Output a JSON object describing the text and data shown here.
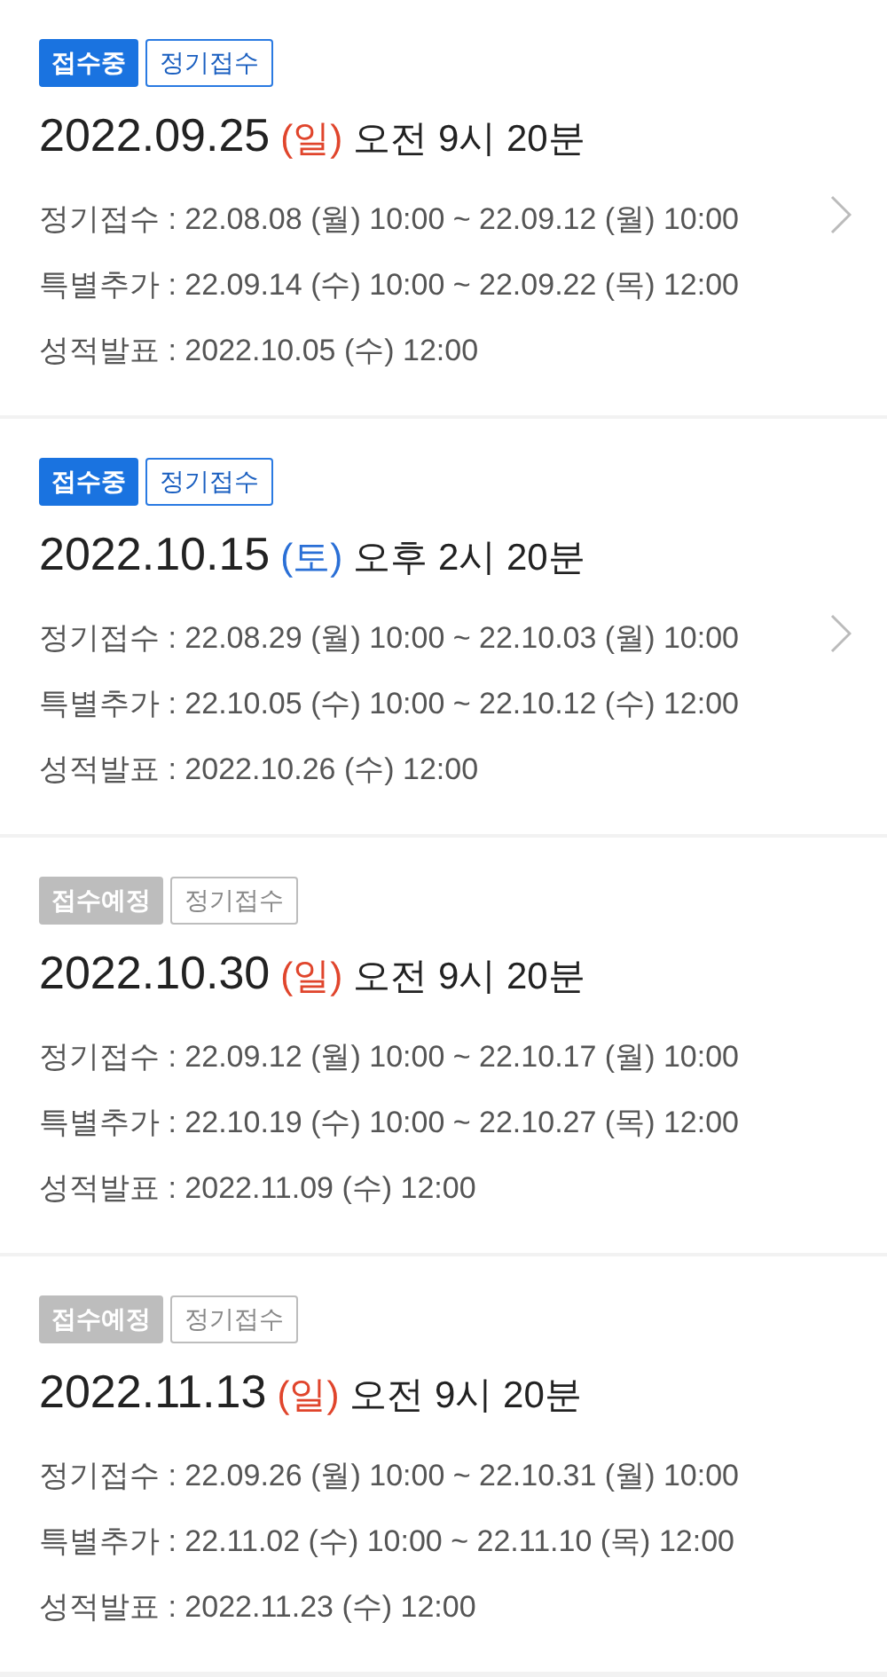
{
  "exams": [
    {
      "status": {
        "label": "접수중",
        "kind": "open"
      },
      "type": "정기접수",
      "date": "2022.09.25",
      "day": {
        "label": "(일)",
        "color": "#e0452c"
      },
      "time": "오전 9시 20분",
      "chevron": true,
      "rows": [
        "정기접수 : 22.08.08 (월) 10:00 ~ 22.09.12 (월) 10:00",
        "특별추가 : 22.09.14 (수) 10:00 ~ 22.09.22 (목) 12:00",
        "성적발표 : 2022.10.05 (수) 12:00"
      ]
    },
    {
      "status": {
        "label": "접수중",
        "kind": "open"
      },
      "type": "정기접수",
      "date": "2022.10.15",
      "day": {
        "label": "(토)",
        "color": "#2a6fd6"
      },
      "time": "오후 2시 20분",
      "chevron": true,
      "rows": [
        "정기접수 : 22.08.29 (월) 10:00 ~ 22.10.03 (월) 10:00",
        "특별추가 : 22.10.05 (수) 10:00 ~ 22.10.12 (수) 12:00",
        "성적발표 : 2022.10.26 (수) 12:00"
      ]
    },
    {
      "status": {
        "label": "접수예정",
        "kind": "upcoming"
      },
      "type": "정기접수",
      "date": "2022.10.30",
      "day": {
        "label": "(일)",
        "color": "#e0452c"
      },
      "time": "오전 9시 20분",
      "chevron": false,
      "rows": [
        "정기접수 : 22.09.12 (월) 10:00 ~ 22.10.17 (월) 10:00",
        "특별추가 : 22.10.19 (수) 10:00 ~ 22.10.27 (목) 12:00",
        "성적발표 : 2022.11.09 (수) 12:00"
      ]
    },
    {
      "status": {
        "label": "접수예정",
        "kind": "upcoming"
      },
      "type": "정기접수",
      "date": "2022.11.13",
      "day": {
        "label": "(일)",
        "color": "#e0452c"
      },
      "time": "오전 9시 20분",
      "chevron": false,
      "rows": [
        "정기접수 : 22.09.26 (월) 10:00 ~ 22.10.31 (월) 10:00",
        "특별추가 : 22.11.02 (수) 10:00 ~ 22.11.10 (목) 12:00",
        "성적발표 : 2022.11.23 (수) 12:00"
      ]
    }
  ]
}
